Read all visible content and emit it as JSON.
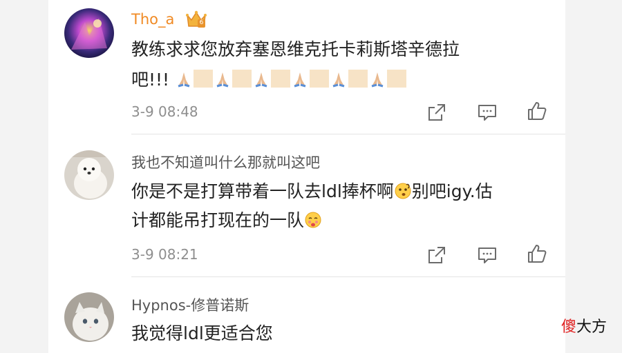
{
  "colors": {
    "vip_username": "#f08a24",
    "username": "#555555",
    "text": "#222222",
    "timestamp": "#8e8e8e",
    "icon": "#6b6b6b",
    "watermark_red": "#e02020",
    "watermark_black": "#111111"
  },
  "comments": [
    {
      "username": "Tho_a",
      "badge_icon": "crown-icon",
      "badge_level": "6",
      "line1": "教练求求您放弃塞恩维克托卡莉斯塔辛德拉",
      "line2": "吧!!!",
      "timestamp": "3-9 08:48"
    },
    {
      "username": "我也不知道叫什么那就叫这吧",
      "line1a": "你是不是打算带着一队去ldl捧杯啊",
      "line1b": "别吧igy.估",
      "line2": "计都能吊打现在的一队",
      "timestamp": "3-9 08:21"
    },
    {
      "username": "Hypnos-修普诺斯",
      "line1": "我觉得ldl更适合您"
    }
  ],
  "watermark": {
    "char1": "傻",
    "rest": "大方"
  }
}
